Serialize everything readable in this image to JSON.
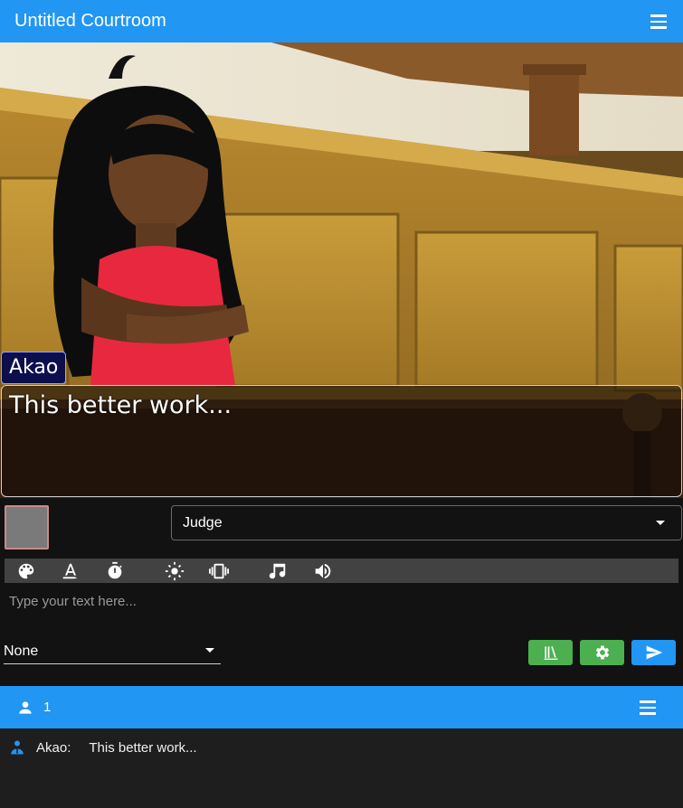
{
  "app": {
    "title": "Untitled Courtroom"
  },
  "scene": {
    "speaker": "Akao",
    "message": "This better work..."
  },
  "controls": {
    "position_select": "Judge",
    "toolbar_icons": [
      "palette-icon",
      "text-color-icon",
      "timer-icon",
      "brightness-icon",
      "vibrate-icon",
      "music-note-icon",
      "volume-icon"
    ],
    "text_placeholder": "Type your text here...",
    "effect_select": "None",
    "buttons": [
      "library-icon",
      "gear-icon",
      "send-icon"
    ],
    "colors": {
      "green": "#4caf50",
      "blue": "#2196f3"
    }
  },
  "userbar": {
    "count": "1"
  },
  "log": {
    "entries": [
      {
        "name": "Akao:",
        "text": "This better work..."
      }
    ]
  }
}
